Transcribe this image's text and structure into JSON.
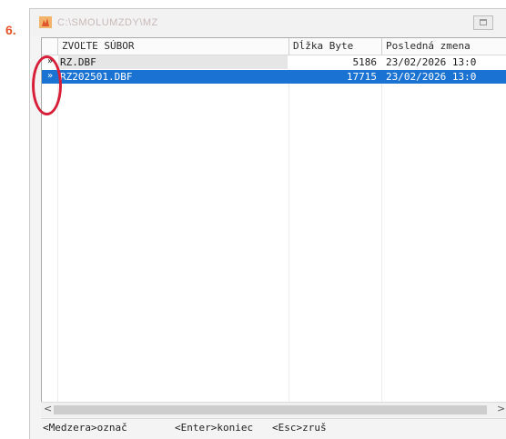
{
  "step_label": "6.",
  "window": {
    "title": "C:\\SMOLUMZDY\\MZ",
    "title_icon": "app-flame-icon"
  },
  "table": {
    "headers": [
      "ZVOĽTE SÚBOR",
      "Dĺžka Byte",
      "Posledná zmena"
    ],
    "rows": [
      {
        "marker": "»",
        "name": "RZ.DBF",
        "size": "5186",
        "modified": "23/02/2026 13:0",
        "selected": false
      },
      {
        "marker": "»",
        "name": "RZ202501.DBF",
        "size": "17715",
        "modified": "23/02/2026 13:0",
        "selected": true
      }
    ]
  },
  "scrollbar": {
    "left_arrow": "<",
    "right_arrow": ">"
  },
  "status_bar": {
    "hint_mark": "<Medzera>označ",
    "hint_enter": "<Enter>koniec",
    "hint_esc": "<Esc>zruš"
  },
  "colors": {
    "selection": "#1a72d2",
    "annotation": "#d81f3a",
    "step_label": "#e5532a"
  }
}
